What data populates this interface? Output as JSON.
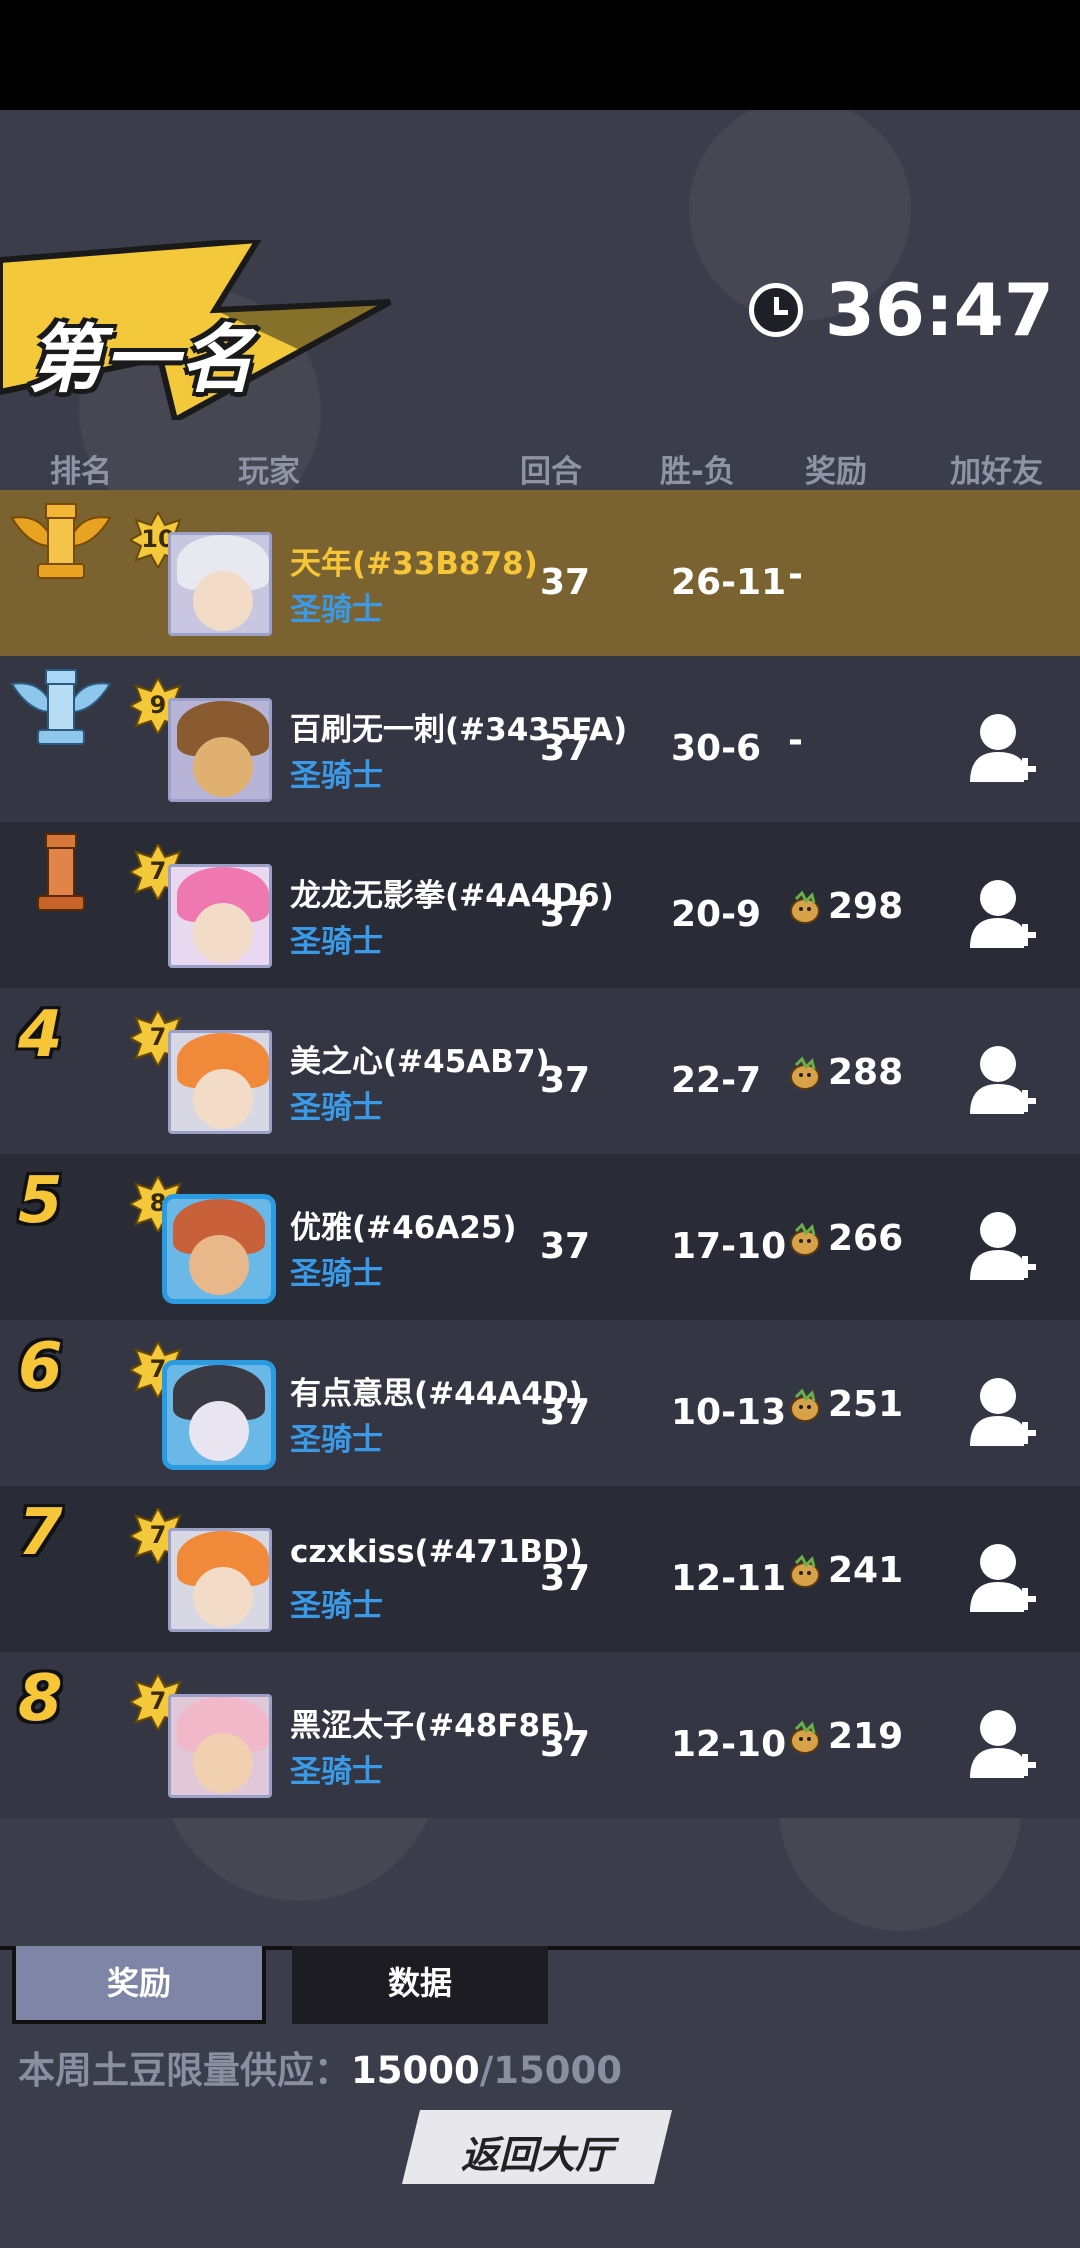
{
  "title": "第一名",
  "timer": "36:47",
  "headers": {
    "rank": "排名",
    "player": "玩家",
    "rounds": "回合",
    "winloss": "胜-负",
    "reward": "奖励",
    "add_friend": "加好友"
  },
  "rows": [
    {
      "rank": "1",
      "level": "10",
      "name": "天年(#33B878)",
      "cls": "圣骑士",
      "rounds": "37",
      "wl": "26-11",
      "reward": "-",
      "me": true
    },
    {
      "rank": "2",
      "level": "9",
      "name": "百刷无一刺(#3435FA)",
      "cls": "圣骑士",
      "rounds": "37",
      "wl": "30-6",
      "reward": "-"
    },
    {
      "rank": "3",
      "level": "7",
      "name": "龙龙无影拳(#4A4D6)",
      "cls": "圣骑士",
      "rounds": "37",
      "wl": "20-9",
      "reward": "298"
    },
    {
      "rank": "4",
      "level": "7",
      "name": "美之心(#45AB7)",
      "cls": "圣骑士",
      "rounds": "37",
      "wl": "22-7",
      "reward": "288"
    },
    {
      "rank": "5",
      "level": "8",
      "name": "优雅(#46A25)",
      "cls": "圣骑士",
      "rounds": "37",
      "wl": "17-10",
      "reward": "266"
    },
    {
      "rank": "6",
      "level": "7",
      "name": "有点意思(#44A4D)",
      "cls": "圣骑士",
      "rounds": "37",
      "wl": "10-13",
      "reward": "251"
    },
    {
      "rank": "7",
      "level": "7",
      "name": "czxkiss(#471BD)",
      "cls": "圣骑士",
      "rounds": "37",
      "wl": "12-11",
      "reward": "241"
    },
    {
      "rank": "8",
      "level": "7",
      "name": "黑涩太子(#48F8F)",
      "cls": "圣骑士",
      "rounds": "37",
      "wl": "12-10",
      "reward": "219"
    }
  ],
  "tabs": {
    "reward": "奖励",
    "data": "数据"
  },
  "supply": {
    "label": "本周土豆限量供应：",
    "current": "15000",
    "sep_total": "/15000"
  },
  "back_button": "返回大厅",
  "colors": {
    "gold": "#f6c638",
    "class_blue": "#3a9ae8",
    "highlight": "#7a6330"
  }
}
